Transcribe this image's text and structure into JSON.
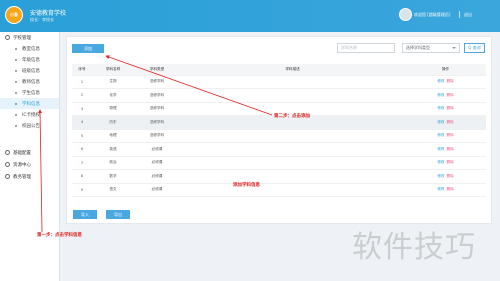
{
  "app": {
    "logo_text": "小鱼",
    "title": "安德教育学校",
    "subtitle": "校长：李校长",
    "user_text": "欢迎您 [超级管理员]",
    "logout": "退出"
  },
  "sidebar": {
    "groups": [
      {
        "label": "学校管理"
      },
      {
        "label": "基础配置"
      },
      {
        "label": "资源中心"
      },
      {
        "label": "教务管理"
      }
    ],
    "items": [
      {
        "label": "教室信息"
      },
      {
        "label": "年级信息"
      },
      {
        "label": "班级信息"
      },
      {
        "label": "教师信息"
      },
      {
        "label": "学生信息"
      },
      {
        "label": "学科信息"
      },
      {
        "label": "IC卡授权"
      },
      {
        "label": "校园公告"
      }
    ]
  },
  "toolbar": {
    "add_label": "添加",
    "search_placeholder": "学科名称",
    "select_value": "选择学科类型",
    "search_label": "Q 查询"
  },
  "table": {
    "headers": [
      "序号",
      "学科名称",
      "学科类型",
      "学科描述",
      "操作"
    ],
    "edit_label": "修改",
    "delete_label": "删除",
    "rows": [
      [
        "1",
        "生物",
        "选修学科",
        ""
      ],
      [
        "2",
        "化学",
        "选修学科",
        ""
      ],
      [
        "3",
        "物理",
        "选修学科",
        ""
      ],
      [
        "4",
        "历史",
        "选修学科",
        ""
      ],
      [
        "5",
        "地理",
        "选修学科",
        ""
      ],
      [
        "6",
        "英语",
        "必修课",
        ""
      ],
      [
        "7",
        "政治",
        "必修课",
        ""
      ],
      [
        "8",
        "数学",
        "必修课",
        ""
      ],
      [
        "9",
        "语文",
        "必修课",
        ""
      ]
    ]
  },
  "footer": {
    "import_label": "导入",
    "export_label": "导出"
  },
  "annotations": {
    "step1": "第一步：点击学科信息",
    "step2": "第二步：点击添加",
    "note": "添加学科信息"
  },
  "watermark": "软件技巧",
  "colors": {
    "header": "#2a9fd8",
    "accent": "#4aa8e0",
    "annotation": "#e02424",
    "delete": "#e9557c"
  }
}
